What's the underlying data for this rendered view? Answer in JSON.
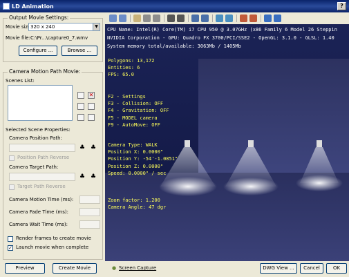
{
  "window": {
    "title": "LD Animation",
    "help": "?"
  },
  "output": {
    "legend": "Output Movie Settings:",
    "movie_size_label": "Movie size:",
    "movie_size_value": "320 x 240",
    "movie_file_label": "Movie file:",
    "movie_file_value": "C:\\Pr...\\capture0_7.wmv",
    "configure_label": "Configure ...",
    "browse_label": "Browse ..."
  },
  "camera_motion": {
    "legend": "Camera Motion Path Movie:",
    "scenes_list_label": "Scenes List:",
    "selected_props_label": "Selected Scene Properties:",
    "position_path_label": "Camera Position Path:",
    "position_reverse_label": "Position Path Reverse",
    "target_path_label": "Camera Target Path:",
    "target_reverse_label": "Target Path Reverse",
    "motion_time_label": "Camera Motion Time (ms):",
    "fade_time_label": "Camera Fade Time (ms):",
    "wait_time_label": "Camera Wait Time (ms):",
    "render_frames_label": "Render frames to create movie",
    "launch_movie_label": "Launch movie when complete"
  },
  "footer": {
    "preview_label": "Preview",
    "create_movie_label": "Create Movie",
    "screen_capture_label": "Screen Capture",
    "dwg_view_label": "DWG View ...",
    "cancel_label": "Cancel",
    "ok_label": "OK"
  },
  "viewport": {
    "info_lines": [
      "CPU Name: Intel(R) Core(TM) i7 CPU 950 @ 3.07GHz (x86 Family 6 Model 26 Steppin",
      "NVIDIA Corporation - GPU: Quadro FX 3700/PCI/SSE2 - OpenGL: 3.1.0 - GLSL: 1.40",
      "System memory total/available: 3063Mb / 1405Mb"
    ],
    "polygons": "Polygons: 13,172",
    "entities": "Entities: 6",
    "fps": "FPS: 65.0",
    "f2": "F2 - Settings",
    "f3": "F3 - Collision: OFF",
    "f4": "F4 - Gravitation: OFF",
    "f5": "F5 - MODEL camera",
    "f9": "F9 - AutoMove: OFF",
    "camera_type": "Camera Type: WALK",
    "pos_x": "Position X: 0.0000\"",
    "pos_y": "Position Y: -54'-1.0851\"",
    "pos_z": "Position Z: 0.0000\"",
    "speed": "Speed: 0.0000\" / sec",
    "zoom": "Zoom factor: 1.200",
    "angle": "Camera Angle: 47 dgr"
  },
  "colors": {
    "hud_text": "#ffff5a",
    "viewport_bg": "#1b2356",
    "title_bar": "#0a246a"
  }
}
